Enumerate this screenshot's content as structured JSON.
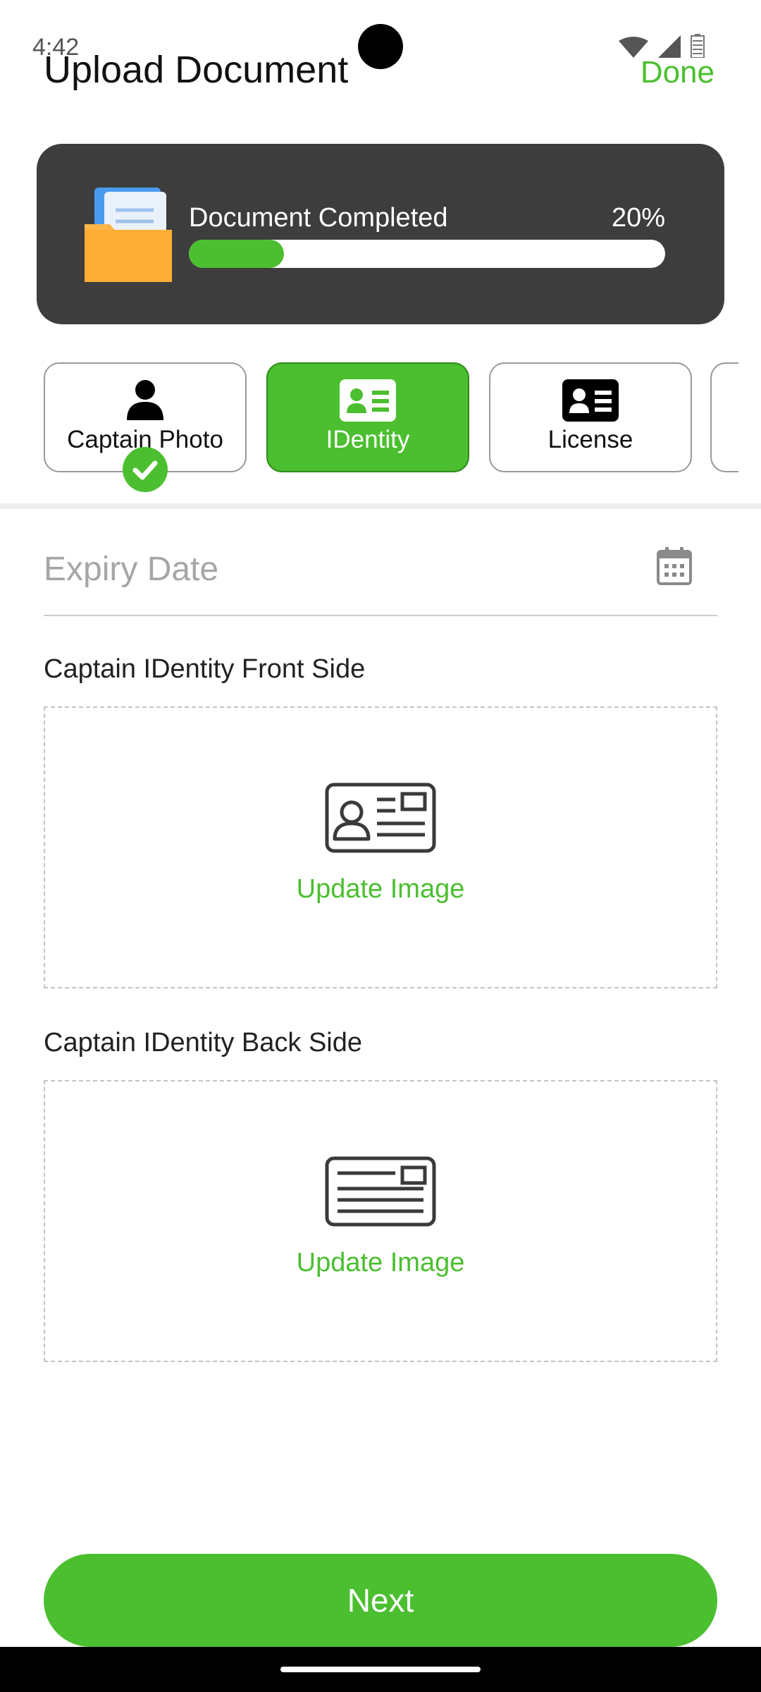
{
  "status_bar": {
    "time": "4:42"
  },
  "header": {
    "title": "Upload Document",
    "done_label": "Done"
  },
  "progress": {
    "label": "Document Completed",
    "percent_text": "20%",
    "fraction": 0.2
  },
  "tabs": [
    {
      "label": "Captain Photo",
      "icon": "person-icon",
      "active": false,
      "completed": true
    },
    {
      "label": "IDentity",
      "icon": "id-card-icon",
      "active": true,
      "completed": false
    },
    {
      "label": "License",
      "icon": "license-card-icon",
      "active": false,
      "completed": false
    }
  ],
  "expiry": {
    "placeholder": "Expiry Date",
    "icon": "calendar-icon"
  },
  "front_side": {
    "label": "Captain IDentity Front Side",
    "action": "Update Image",
    "icon": "id-card-front-icon"
  },
  "back_side": {
    "label": "Captain IDentity Back Side",
    "action": "Update Image",
    "icon": "id-card-back-icon"
  },
  "footer": {
    "next_label": "Next"
  },
  "colors": {
    "accent": "#4bbf2f",
    "card_bg": "#3d3d3d"
  }
}
